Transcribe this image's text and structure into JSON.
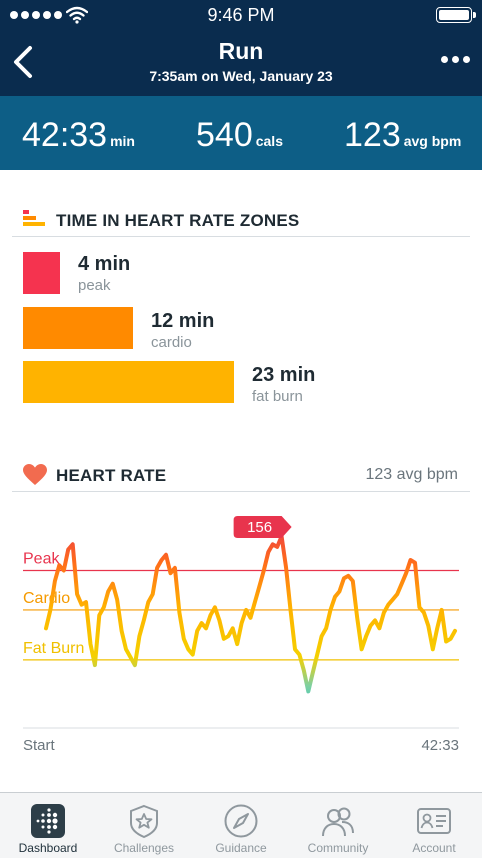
{
  "status_bar": {
    "time": "9:46 PM"
  },
  "header": {
    "title": "Run",
    "subtitle": "7:35am on Wed, January 23"
  },
  "summary": [
    {
      "value": "42:33",
      "unit": "min"
    },
    {
      "value": "540",
      "unit": "cals"
    },
    {
      "value": "123",
      "unit": "avg bpm"
    }
  ],
  "zones_section": {
    "title": "TIME IN HEART RATE ZONES",
    "zones": [
      {
        "value": "4 min",
        "label": "peak",
        "minutes": 4,
        "color": "#f5334f"
      },
      {
        "value": "12 min",
        "label": "cardio",
        "minutes": 12,
        "color": "#ff8a00"
      },
      {
        "value": "23 min",
        "label": "fat burn",
        "minutes": 23,
        "color": "#ffb300"
      }
    ]
  },
  "heart_rate_section": {
    "title": "HEART RATE",
    "avg_label": "123 avg bpm"
  },
  "chart_data": {
    "type": "line",
    "series": [
      {
        "values": [
          118,
          125,
          136,
          142,
          140,
          148,
          150,
          131,
          127,
          128,
          112,
          104,
          123,
          126,
          132,
          135,
          129,
          117,
          110,
          107,
          104,
          115,
          121,
          128,
          131,
          141,
          144,
          146,
          139,
          141,
          124,
          114,
          110,
          108,
          117,
          120,
          118,
          123,
          126,
          121,
          114,
          115,
          118,
          112,
          120,
          125,
          122,
          128,
          134,
          140,
          147,
          150,
          149,
          153,
          141,
          125,
          110,
          108,
          102,
          94,
          101,
          108,
          115,
          118,
          125,
          130,
          132,
          137,
          138,
          136,
          122,
          110,
          115,
          119,
          121,
          118,
          124,
          127,
          129,
          131,
          135,
          139,
          144,
          143,
          126,
          124,
          119,
          110,
          118,
          125,
          113,
          114,
          117
        ]
      }
    ],
    "zone_lines": [
      {
        "label": "Peak",
        "value": 140,
        "color": "#e8344d"
      },
      {
        "label": "Cardio",
        "value": 125,
        "color": "#f59a00"
      },
      {
        "label": "Fat Burn",
        "value": 106,
        "color": "#f0c000"
      }
    ],
    "max_marker": {
      "value": 156,
      "label": "156"
    },
    "x_start_label": "Start",
    "x_end_label": "42:33",
    "ylim": [
      85,
      160
    ]
  },
  "tabs": [
    {
      "label": "Dashboard",
      "icon": "fitbit-logo-icon",
      "active": true
    },
    {
      "label": "Challenges",
      "icon": "star-badge-icon",
      "active": false
    },
    {
      "label": "Guidance",
      "icon": "compass-icon",
      "active": false
    },
    {
      "label": "Community",
      "icon": "people-icon",
      "active": false
    },
    {
      "label": "Account",
      "icon": "id-card-icon",
      "active": false
    }
  ]
}
